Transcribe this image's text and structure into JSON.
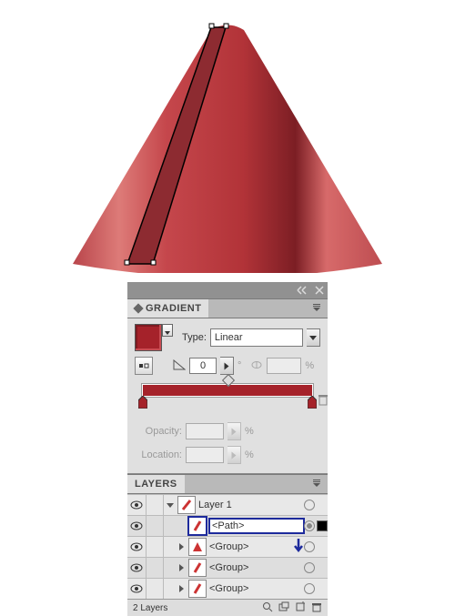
{
  "gradient": {
    "panel_title": "GRADIENT",
    "type_label": "Type:",
    "type_value": "Linear",
    "angle_value": "0",
    "angle_unit": "°",
    "ratio_suffix": "%",
    "opacity_label": "Opacity:",
    "opacity_suffix": "%",
    "location_label": "Location:",
    "location_suffix": "%",
    "swatch_color": "#a5222a",
    "stops": [
      {
        "pos": 0,
        "color": "#a5222a"
      },
      {
        "pos": 100,
        "color": "#a5222a"
      }
    ]
  },
  "layers": {
    "panel_title": "LAYERS",
    "status_text": "2 Layers",
    "rows": [
      {
        "name": "Layer 1",
        "type": "layer",
        "expanded": true
      },
      {
        "name": "<Path>",
        "type": "item",
        "highlight": true,
        "selected": true,
        "thumb": "slash"
      },
      {
        "name": "<Group>",
        "type": "item",
        "expanded": false,
        "thumb": "cone"
      },
      {
        "name": "<Group>",
        "type": "item",
        "expanded": false,
        "thumb": "slash"
      },
      {
        "name": "<Group>",
        "type": "item",
        "expanded": false,
        "thumb": "slash"
      }
    ]
  },
  "icons": {
    "close": "close-icon",
    "menu": "panel-menu-icon",
    "collapse": "collapse-icon",
    "reverse": "reverse-gradient-icon",
    "angle": "angle-icon",
    "ratio": "aspect-ratio-icon",
    "trash": "trash-icon",
    "eye": "visibility-icon",
    "new": "new-layer-icon",
    "sublayer": "new-sublayer-icon",
    "locate": "locate-object-icon",
    "delete": "delete-icon",
    "gradient": "gradient-icon",
    "diamond": "gradient-midpoint-icon"
  }
}
